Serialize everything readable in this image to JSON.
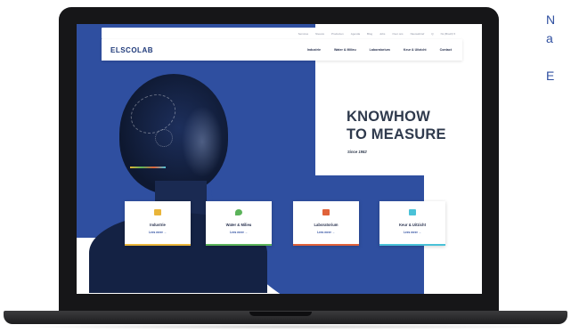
{
  "site": {
    "topbar_links": [
      "Services",
      "Nieuws",
      "Producten",
      "Agenda",
      "Blog",
      "Jobs",
      "Over ons",
      "Nieuwsbrief",
      "Q",
      "NL (Brazil) ▾"
    ],
    "logo": "ELSCOLAB",
    "nav": [
      "Industrie",
      "Water & Milieu",
      "Laboratorium",
      "Keur & Uitzicht",
      "Contact"
    ],
    "headline_line1": "KNOWHOW",
    "headline_line2": "TO MEASURE",
    "since": "Since 1982",
    "cards": [
      {
        "title": "Industrie",
        "more": "Lees meer →",
        "color": "#e9b53a"
      },
      {
        "title": "Water & Milieu",
        "more": "Lees meer →",
        "color": "#5bb35a"
      },
      {
        "title": "Laboratorium",
        "more": "Lees meer →",
        "color": "#e0623a"
      },
      {
        "title": "Keur & Uitzicht",
        "more": "Lees meer →",
        "color": "#4ac2d8"
      }
    ]
  },
  "side": {
    "line1": "N",
    "line2": "a",
    "line3": "E"
  },
  "colors": {
    "brand_blue": "#2f4fa0",
    "headline": "#2f3a4d"
  }
}
